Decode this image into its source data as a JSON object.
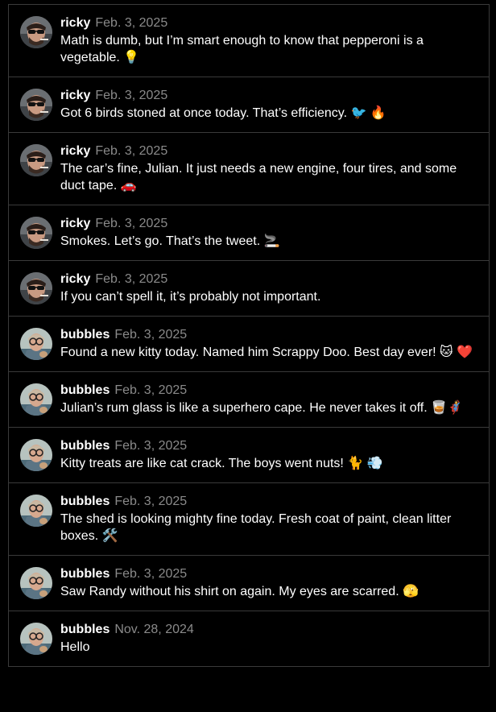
{
  "posts": [
    {
      "user": "ricky",
      "avatar": "ricky",
      "date": "Feb. 3, 2025",
      "text": "Math is dumb, but I’m smart enough to know that pepperoni is a vegetable. 💡"
    },
    {
      "user": "ricky",
      "avatar": "ricky",
      "date": "Feb. 3, 2025",
      "text": "Got 6 birds stoned at once today. That’s efficiency. 🐦 🔥"
    },
    {
      "user": "ricky",
      "avatar": "ricky",
      "date": "Feb. 3, 2025",
      "text": "The car’s fine, Julian. It just needs a new engine, four tires, and some duct tape. 🚗"
    },
    {
      "user": "ricky",
      "avatar": "ricky",
      "date": "Feb. 3, 2025",
      "text": "Smokes. Let’s go. That’s the tweet. 🚬"
    },
    {
      "user": "ricky",
      "avatar": "ricky",
      "date": "Feb. 3, 2025",
      "text": "If you can’t spell it, it’s probably not important."
    },
    {
      "user": "bubbles",
      "avatar": "bubbles",
      "date": "Feb. 3, 2025",
      "text": "Found a new kitty today. Named him Scrappy Doo. Best day ever! 🐱 ❤️"
    },
    {
      "user": "bubbles",
      "avatar": "bubbles",
      "date": "Feb. 3, 2025",
      "text": "Julian’s rum glass is like a superhero cape. He never takes it off. 🥃🦸"
    },
    {
      "user": "bubbles",
      "avatar": "bubbles",
      "date": "Feb. 3, 2025",
      "text": "Kitty treats are like cat crack. The boys went nuts! 🐈 💨"
    },
    {
      "user": "bubbles",
      "avatar": "bubbles",
      "date": "Feb. 3, 2025",
      "text": "The shed is looking mighty fine today. Fresh coat of paint, clean litter boxes. 🛠️"
    },
    {
      "user": "bubbles",
      "avatar": "bubbles",
      "date": "Feb. 3, 2025",
      "text": "Saw Randy without his shirt on again. My eyes are scarred. 🫣"
    },
    {
      "user": "bubbles",
      "avatar": "bubbles",
      "date": "Nov. 28, 2024",
      "text": "Hello"
    }
  ],
  "colors": {
    "background": "#000000",
    "border": "#3a3a3a",
    "username": "#ffffff",
    "date": "#8a8a8a",
    "text": "#ffffff"
  }
}
